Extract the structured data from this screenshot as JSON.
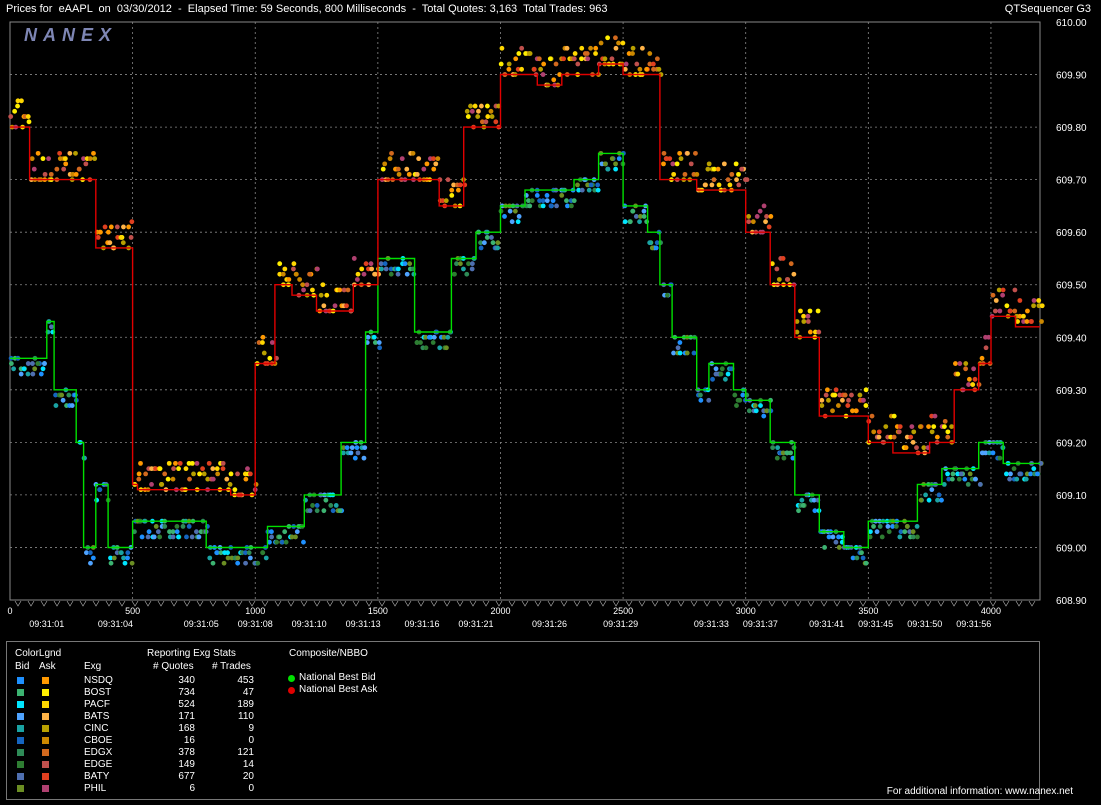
{
  "header": {
    "title": "Prices for  eAAPL  on  03/30/2012  -  Elapsed Time: 59 Seconds, 800 Milliseconds  -  Total Quotes: 3,163  Total Trades: 963",
    "tool": "QTSequencer G3",
    "logo": "NANEX"
  },
  "colors": {
    "national_best_bid": "#00e000",
    "national_best_ask": "#e00000",
    "grid": "#888888",
    "background": "#000000"
  },
  "chart_data": {
    "type": "scatter",
    "title": "",
    "xlabel": "",
    "ylabel": "",
    "xlim": [
      0,
      4200
    ],
    "ylim": [
      608.9,
      610.0
    ],
    "y_ticks": [
      608.9,
      609.0,
      609.1,
      609.2,
      609.3,
      609.4,
      609.5,
      609.6,
      609.7,
      609.8,
      609.9,
      610.0
    ],
    "y_tick_labels": [
      "608.90",
      "609.00",
      "609.10",
      "609.20",
      "609.30",
      "609.40",
      "609.50",
      "609.60",
      "609.70",
      "609.80",
      "609.90",
      "610.00"
    ],
    "x_ticks": [
      0,
      500,
      1000,
      1500,
      2000,
      2500,
      3000,
      3500,
      4000
    ],
    "x_tick_labels": [
      "0",
      "500",
      "1000",
      "1500",
      "2000",
      "2500",
      "3000",
      "3500",
      "4000"
    ],
    "time_labels": [
      {
        "x": 150,
        "label": "09:31:01"
      },
      {
        "x": 430,
        "label": "09:31:04"
      },
      {
        "x": 780,
        "label": "09:31:05"
      },
      {
        "x": 1000,
        "label": "09:31:08"
      },
      {
        "x": 1220,
        "label": "09:31:10"
      },
      {
        "x": 1440,
        "label": "09:31:13"
      },
      {
        "x": 1680,
        "label": "09:31:16"
      },
      {
        "x": 1900,
        "label": "09:31:21"
      },
      {
        "x": 2200,
        "label": "09:31:26"
      },
      {
        "x": 2490,
        "label": "09:31:29"
      },
      {
        "x": 2860,
        "label": "09:31:33"
      },
      {
        "x": 3060,
        "label": "09:31:37"
      },
      {
        "x": 3330,
        "label": "09:31:41"
      },
      {
        "x": 3530,
        "label": "09:31:45"
      },
      {
        "x": 3730,
        "label": "09:31:50"
      },
      {
        "x": 3930,
        "label": "09:31:56"
      }
    ],
    "grid": true,
    "series": [
      {
        "name": "National Best Bid",
        "x": [
          0,
          150,
          150,
          180,
          180,
          270,
          270,
          300,
          300,
          350,
          350,
          400,
          400,
          500,
          500,
          800,
          800,
          1050,
          1050,
          1200,
          1200,
          1250,
          1250,
          1350,
          1350,
          1450,
          1450,
          1500,
          1500,
          1650,
          1650,
          1800,
          1800,
          1900,
          1900,
          2000,
          2000,
          2100,
          2100,
          2200,
          2200,
          2300,
          2300,
          2400,
          2400,
          2500,
          2500,
          2600,
          2600,
          2650,
          2650,
          2700,
          2700,
          2800,
          2800,
          2850,
          2850,
          2950,
          2950,
          3000,
          3000,
          3100,
          3100,
          3200,
          3200,
          3300,
          3300,
          3400,
          3400,
          3500,
          3500,
          3700,
          3700,
          3800,
          3800,
          3950,
          3950,
          4050,
          4050,
          4100,
          4100,
          4200
        ],
        "y": [
          609.36,
          609.36,
          609.43,
          609.43,
          609.3,
          609.3,
          609.2,
          609.2,
          609.0,
          609.0,
          609.12,
          609.12,
          609.0,
          609.0,
          609.05,
          609.05,
          609.0,
          609.0,
          609.04,
          609.04,
          609.1,
          609.1,
          609.1,
          609.1,
          609.2,
          609.2,
          609.41,
          609.41,
          609.55,
          609.55,
          609.41,
          609.41,
          609.55,
          609.55,
          609.6,
          609.6,
          609.65,
          609.65,
          609.68,
          609.68,
          609.68,
          609.68,
          609.7,
          609.7,
          609.75,
          609.75,
          609.65,
          609.65,
          609.6,
          609.6,
          609.5,
          609.5,
          609.4,
          609.4,
          609.3,
          609.3,
          609.35,
          609.35,
          609.3,
          609.3,
          609.28,
          609.28,
          609.2,
          609.2,
          609.1,
          609.1,
          609.03,
          609.03,
          609.0,
          609.0,
          609.05,
          609.05,
          609.12,
          609.12,
          609.15,
          609.15,
          609.2,
          609.2,
          609.16,
          609.16,
          609.16,
          609.16
        ]
      },
      {
        "name": "National Best Ask",
        "x": [
          0,
          80,
          80,
          350,
          350,
          500,
          500,
          520,
          520,
          900,
          900,
          1000,
          1000,
          1080,
          1080,
          1150,
          1150,
          1250,
          1250,
          1400,
          1400,
          1500,
          1500,
          1750,
          1750,
          1850,
          1850,
          2000,
          2000,
          2150,
          2150,
          2250,
          2250,
          2400,
          2400,
          2500,
          2500,
          2650,
          2650,
          2800,
          2800,
          3000,
          3000,
          3100,
          3100,
          3200,
          3200,
          3300,
          3300,
          3500,
          3500,
          3600,
          3600,
          3750,
          3750,
          3850,
          3850,
          3950,
          3950,
          4000,
          4000,
          4100,
          4100,
          4200
        ],
        "y": [
          609.8,
          609.8,
          609.7,
          609.7,
          609.57,
          609.57,
          609.12,
          609.12,
          609.11,
          609.11,
          609.1,
          609.1,
          609.35,
          609.35,
          609.5,
          609.5,
          609.48,
          609.48,
          609.45,
          609.45,
          609.5,
          609.5,
          609.7,
          609.7,
          609.65,
          609.65,
          609.8,
          609.8,
          609.9,
          609.9,
          609.88,
          609.88,
          609.9,
          609.9,
          609.92,
          609.92,
          609.9,
          609.9,
          609.7,
          609.7,
          609.68,
          609.68,
          609.6,
          609.6,
          609.5,
          609.5,
          609.4,
          609.4,
          609.25,
          609.25,
          609.2,
          609.2,
          609.18,
          609.18,
          609.2,
          609.2,
          609.3,
          609.3,
          609.35,
          609.35,
          609.44,
          609.44,
          609.42,
          609.42
        ]
      }
    ]
  },
  "legend": {
    "colorlgnd": "ColorLgnd",
    "bid": "Bid",
    "ask": "Ask",
    "exg_header": "Exg",
    "stats_title": "Reporting Exg Stats",
    "quotes_header": "# Quotes",
    "trades_header": "# Trades",
    "composite_title": "Composite/NBBO",
    "nbb_label": "National Best Bid",
    "nba_label": "National Best Ask",
    "rows": [
      {
        "exg": "NSDQ",
        "quotes": "340",
        "trades": "453",
        "bid_color": "#1e90ff",
        "ask_color": "#ff9900"
      },
      {
        "exg": "BOST",
        "quotes": "734",
        "trades": "47",
        "bid_color": "#3cb371",
        "ask_color": "#ffee00"
      },
      {
        "exg": "PACF",
        "quotes": "524",
        "trades": "189",
        "bid_color": "#00e5ff",
        "ask_color": "#ffd700"
      },
      {
        "exg": "BATS",
        "quotes": "171",
        "trades": "110",
        "bid_color": "#4fa3ff",
        "ask_color": "#ffb347"
      },
      {
        "exg": "CINC",
        "quotes": "168",
        "trades": "9",
        "bid_color": "#1aa3a3",
        "ask_color": "#b8a000"
      },
      {
        "exg": "CBOE",
        "quotes": "16",
        "trades": "0",
        "bid_color": "#1565c0",
        "ask_color": "#cc8800"
      },
      {
        "exg": "EDGX",
        "quotes": "378",
        "trades": "121",
        "bid_color": "#2e8b57",
        "ask_color": "#d2691e"
      },
      {
        "exg": "EDGE",
        "quotes": "149",
        "trades": "14",
        "bid_color": "#2e7d32",
        "ask_color": "#c0504d"
      },
      {
        "exg": "BATY",
        "quotes": "677",
        "trades": "20",
        "bid_color": "#4f6fb0",
        "ask_color": "#e04020"
      },
      {
        "exg": "PHIL",
        "quotes": "6",
        "trades": "0",
        "bid_color": "#6b8e23",
        "ask_color": "#b04070"
      }
    ]
  },
  "footer": "For additional information: www.nanex.net"
}
